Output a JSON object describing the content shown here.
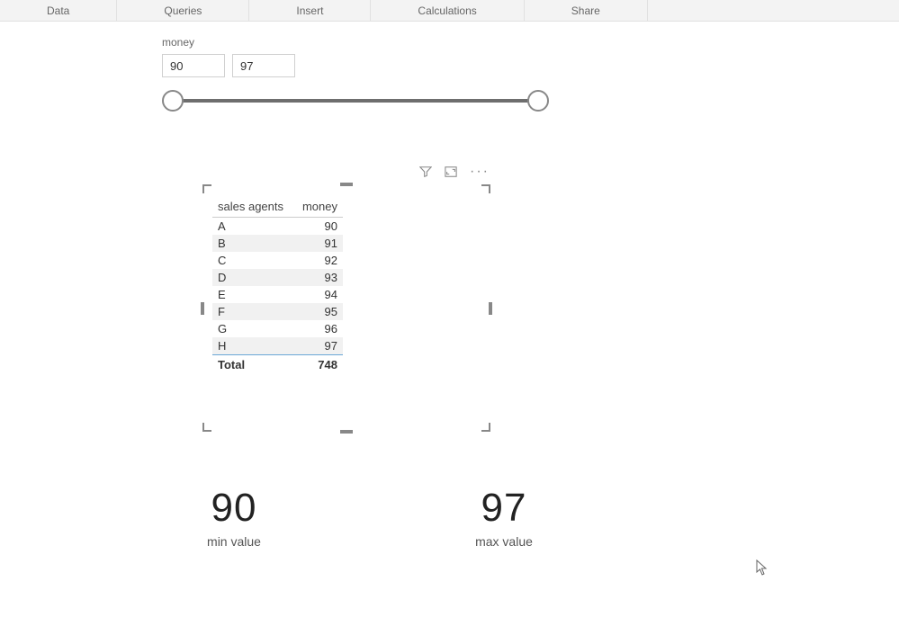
{
  "ribbon": {
    "items": [
      "Data",
      "Queries",
      "Insert",
      "Calculations",
      "Share"
    ]
  },
  "slicer": {
    "title": "money",
    "min_value": "90",
    "max_value": "97"
  },
  "table": {
    "columns": [
      "sales agents",
      "money"
    ],
    "rows": [
      {
        "agent": "A",
        "money": "90"
      },
      {
        "agent": "B",
        "money": "91"
      },
      {
        "agent": "C",
        "money": "92"
      },
      {
        "agent": "D",
        "money": "93"
      },
      {
        "agent": "E",
        "money": "94"
      },
      {
        "agent": "F",
        "money": "95"
      },
      {
        "agent": "G",
        "money": "96"
      },
      {
        "agent": "H",
        "money": "97"
      }
    ],
    "total_label": "Total",
    "total_value": "748"
  },
  "kpi": {
    "min": {
      "value": "90",
      "label": "min value"
    },
    "max": {
      "value": "97",
      "label": "max value"
    }
  }
}
